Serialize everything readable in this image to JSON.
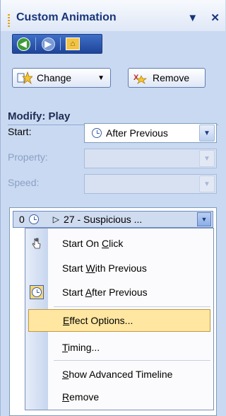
{
  "pane": {
    "title": "Custom Animation",
    "dropdown_glyph": "▼",
    "close_glyph": "✕"
  },
  "nav": {
    "back_icon": "back-arrow-icon",
    "forward_icon": "forward-arrow-icon",
    "home_icon": "home-icon"
  },
  "toolbar": {
    "change_label": "Change",
    "remove_label": "Remove"
  },
  "modify": {
    "heading": "Modify: Play",
    "start_label": "Start:",
    "start_value": "After Previous",
    "property_label": "Property:",
    "property_value": "",
    "speed_label": "Speed:",
    "speed_value": ""
  },
  "effect_item": {
    "order": "0",
    "name": "27 - Suspicious ..."
  },
  "menu": {
    "items": [
      {
        "pre": "Start On ",
        "key": "C",
        "post": "lick"
      },
      {
        "pre": "Start ",
        "key": "W",
        "post": "ith Previous"
      },
      {
        "pre": "Start ",
        "key": "A",
        "post": "fter Previous"
      },
      {
        "pre": "",
        "key": "E",
        "post": "ffect Options..."
      },
      {
        "pre": "",
        "key": "T",
        "post": "iming..."
      },
      {
        "pre": "",
        "key": "S",
        "post": "how Advanced Timeline"
      },
      {
        "pre": "",
        "key": "R",
        "post": "emove"
      }
    ]
  },
  "colors": {
    "accent": "#17357a",
    "highlight": "#ffe7a2"
  }
}
